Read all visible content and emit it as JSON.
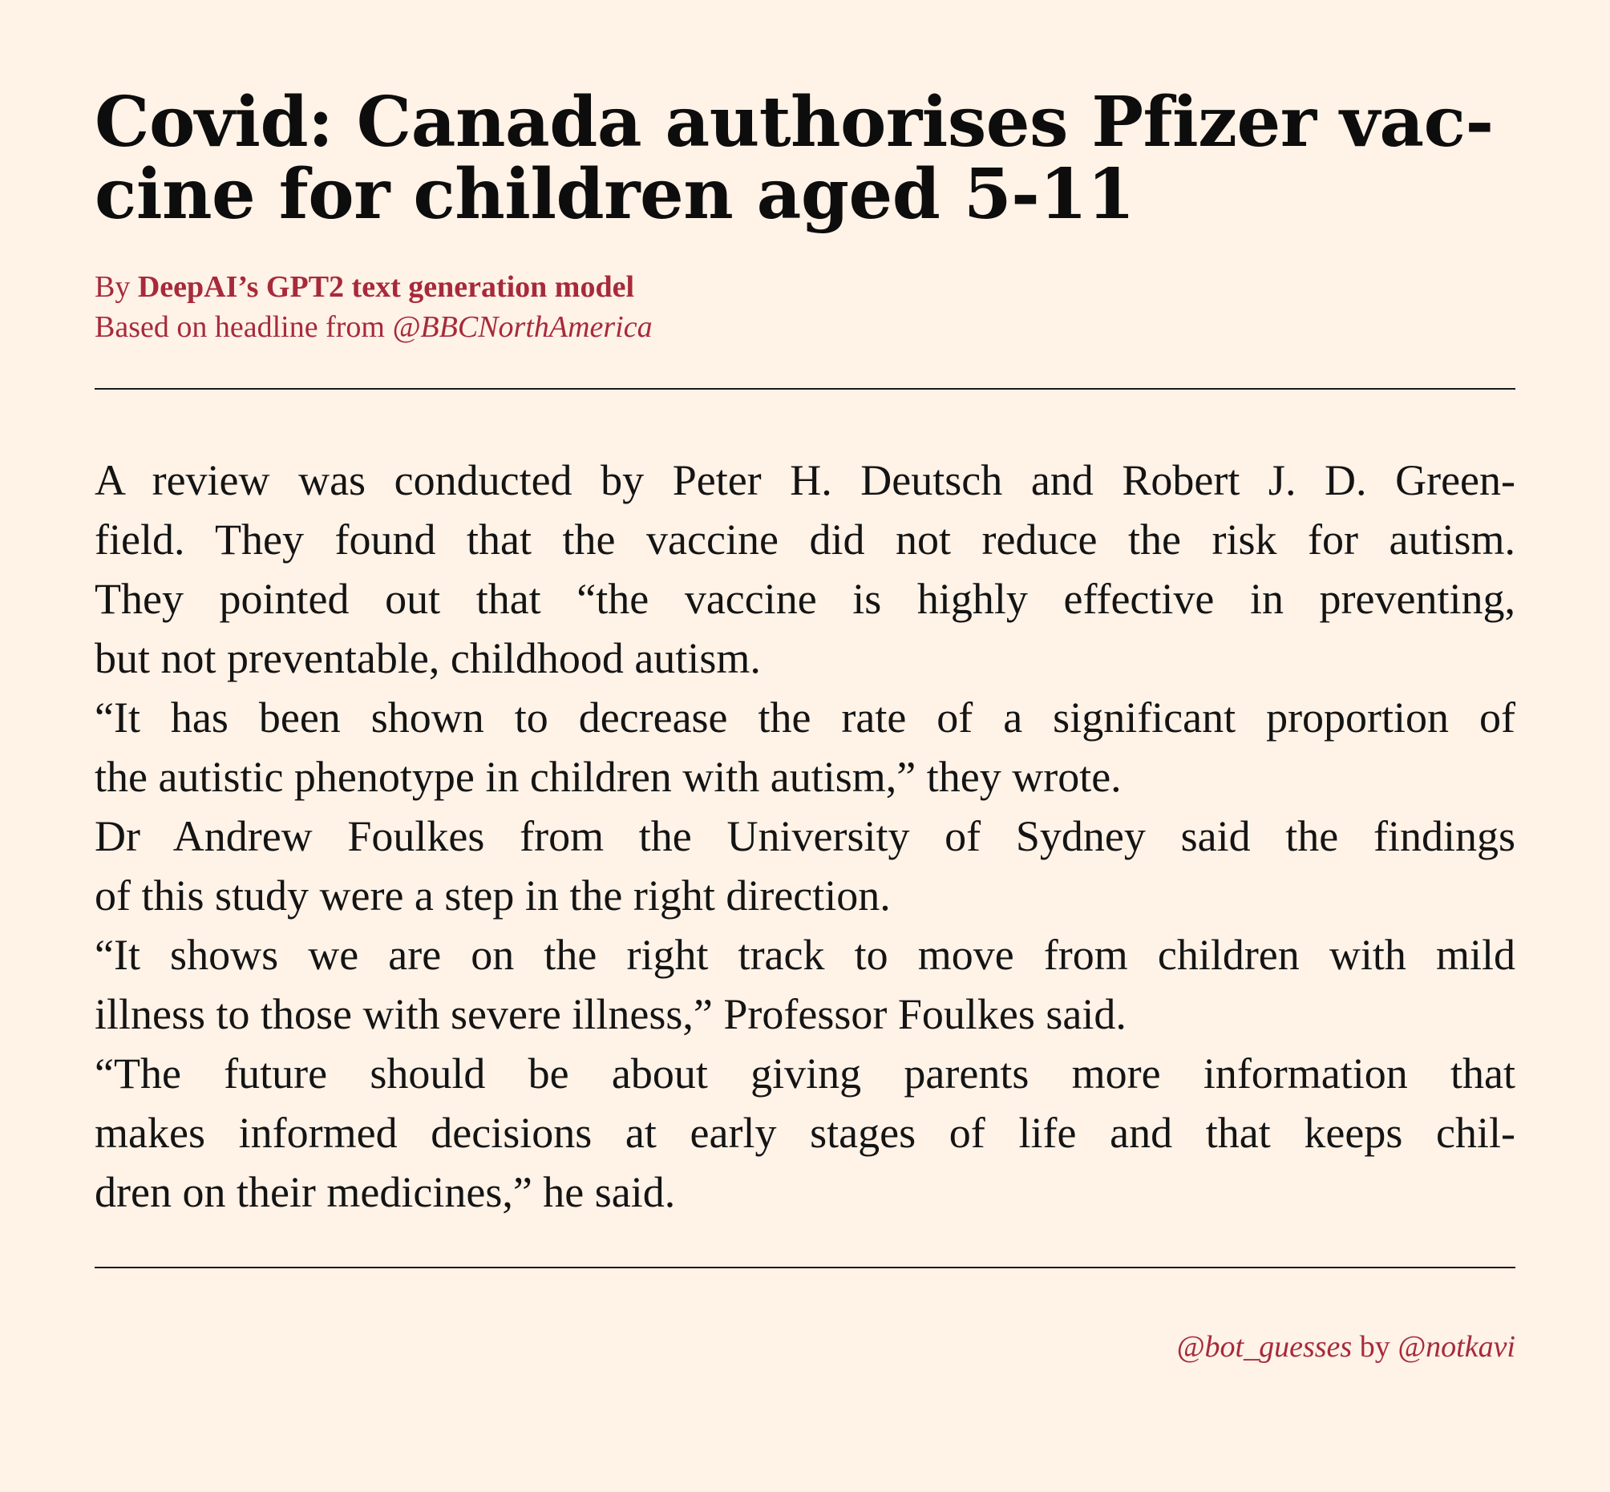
{
  "article": {
    "headline_lines": [
      "Covid:  Canada authorises Pfizer vac-",
      "cine for children aged 5-11"
    ],
    "byline_prefix": "By ",
    "byline_author": "DeepAI’s GPT2 text generation model",
    "source_prefix": "Based on headline from ",
    "source_handle": "@BBCNorthAmerica",
    "body_lines": [
      "A review was conducted by Peter H. Deutsch and Robert J. D. Green-",
      "field. They found that the vaccine did not reduce the risk for autism.",
      "They pointed out that “the vaccine is highly effective in preventing,",
      "but not preventable, childhood autism.",
      "“It has been shown to decrease the rate of a significant proportion of",
      "the autistic phenotype in children with autism,” they wrote.",
      "Dr Andrew Foulkes from the University of Sydney said the findings",
      "of this study were a step in the right direction.",
      "“It shows we are on the right track to move from children with mild",
      "illness to those with severe illness,” Professor Foulkes said.",
      "“The future should be about giving parents more information that",
      "makes informed decisions at early stages of life and that keeps chil-",
      "dren on their medicines,” he said."
    ]
  },
  "footer": {
    "bot_handle": "@bot_guesses",
    "by_text": " by ",
    "author_handle": "@notkavi"
  },
  "colors": {
    "background": "#fff2e7",
    "accent": "#a72a3b",
    "text": "#141414"
  }
}
